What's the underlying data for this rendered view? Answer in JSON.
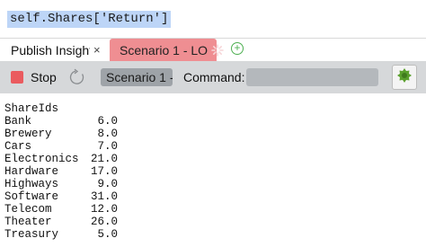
{
  "editor": {
    "code": "self.Shares['Return']"
  },
  "tabs": [
    {
      "label": "Publish Insight a",
      "close": "×"
    },
    {
      "label": "Scenario 1 - LO"
    }
  ],
  "toolbar": {
    "stop_label": "Stop",
    "scenario_value": "Scenario 1 -",
    "command_label": "Command:",
    "command_value": ""
  },
  "output": {
    "index_name": "ShareIds",
    "rows": [
      {
        "name": "Bank",
        "value": "6.0"
      },
      {
        "name": "Brewery",
        "value": "8.0"
      },
      {
        "name": "Cars",
        "value": "7.0"
      },
      {
        "name": "Electronics",
        "value": "21.0"
      },
      {
        "name": "Hardware",
        "value": "17.0"
      },
      {
        "name": "Highways",
        "value": "9.0"
      },
      {
        "name": "Software",
        "value": "31.0"
      },
      {
        "name": "Telecom",
        "value": "12.0"
      },
      {
        "name": "Theater",
        "value": "26.0"
      },
      {
        "name": "Treasury",
        "value": "5.0"
      }
    ]
  },
  "colors": {
    "active_tab": "#ef8e92",
    "stop": "#ea5b5f",
    "add": "#4caf50",
    "run_icon": "#5aa02c",
    "selection": "#bdd5f7"
  },
  "icons": [
    "close-icon",
    "spinner-icon",
    "add-tab-icon",
    "refresh-icon",
    "run-icon"
  ]
}
